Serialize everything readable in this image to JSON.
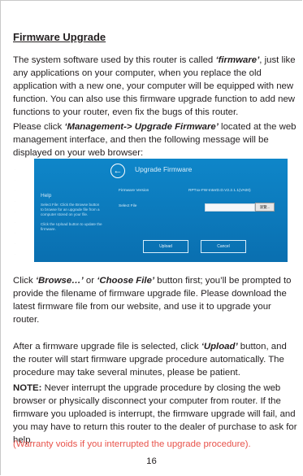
{
  "heading": "Firmware Upgrade",
  "intro": {
    "before": "The system software used by this router is called ",
    "term": "‘firmware’",
    "after": ", just like any applications on your computer, when you replace the old application with a new one, your computer will be equipped with new function. You can also use this firmware upgrade function to add new functions to your router, even fix the bugs of this router."
  },
  "instruction": {
    "before": "Please click ",
    "path": "‘Management-> Upgrade Firmware’",
    "after": " located at the web management interface, and then the following message will be displayed on your web browser:"
  },
  "screenshot": {
    "title": "Upgrade Firmware",
    "back_icon": "arrow-left-circle-icon",
    "help_title": "Help",
    "help_text_1": "Select File: Click the Browse button to browse for an upgrade file from a computer stored on your file.",
    "help_text_2": "Click the Upload button to update the firmware.",
    "firmware_version_label": "Firmware Version",
    "firmware_version_value": "RPTxx-FW-InterD.D.V2.2.1.1(VA00)",
    "select_file_label": "Select File",
    "browse_label": "瀏覽...",
    "upload_label": "Upload",
    "cancel_label": "Cancel",
    "background_color": "#0e86c9"
  },
  "browse": {
    "before": "Click ",
    "browse": "‘Browse…’",
    "mid": " or ",
    "choose": "‘Choose File’",
    "after": " button first; you’ll be prompted to provide the filename of firmware upgrade file. Please download the latest firmware file from our website, and use it to upgrade your router."
  },
  "upload": {
    "before": "After a firmware upgrade file is selected, click ",
    "upload": "‘Upload’",
    "after": " button, and the router will start firmware upgrade procedure automatically. The procedure may take several minutes, please be patient."
  },
  "note": {
    "label": "NOTE:",
    "text": " Never interrupt the upgrade procedure by closing the web browser or physically disconnect your computer from router. If the firmware you uploaded is interrupt, the firmware upgrade will fail, and you may have to return this router to the dealer of purchase to ask for help."
  },
  "warning": "(Warranty voids if you interrupted the upgrade procedure).",
  "warning_color": "#e8534b",
  "page_number": "16"
}
